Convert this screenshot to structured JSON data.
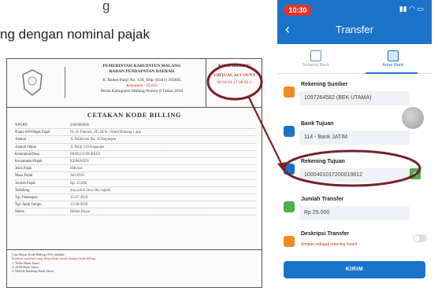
{
  "slide": {
    "top_fragment": "g",
    "heading": "ng dengan nominal pajak"
  },
  "document": {
    "agency_line1": "PEMERINTAH KABUPATEN MALANG",
    "agency_line2": "BADAN PENDAPATAN DAERAH",
    "agency_address": "Jl. Raden Panji No. 158, Telp. (0341) 392685",
    "agency_address2": "Kepanjen - 65163",
    "agency_address3": "Perda Kabupaten Malang Nomor 8 Tahun 2010",
    "kode_title": "KODE BILLING",
    "va_label": "VIRTUAL ACCOUNT",
    "va_number": "00 04 01 17 00 02 2",
    "title": "CETAKAN KODE BILLING",
    "rows": [
      {
        "k": "NPOPD",
        "v": "2000000000"
      },
      {
        "k": "Nama WP/Objek Pajak",
        "v": "Dr. H. Pamudi, SE, M.Si / Hotel Bintang 1 apa"
      },
      {
        "k": "Alamat",
        "v": "Jl. Pahlawan No. 10 Kepanjen"
      },
      {
        "k": "Alamat Objek",
        "v": "Jl. Panji 158 Kepanjen"
      },
      {
        "k": "Kelurahan/Desa",
        "v": "PANGGUNGREJO"
      },
      {
        "k": "Kecamatan/Objek",
        "v": "KEPANJEN"
      },
      {
        "k": "Jenis Pajak",
        "v": "Hiburan"
      },
      {
        "k": "Masa Pajak",
        "v": "Juli 2018"
      },
      {
        "k": "Jumlah Pajak",
        "v": "Rp. 25.000"
      },
      {
        "k": "Terbilang",
        "v": "dua puluh lima ribu rupiah"
      },
      {
        "k": "Tgl. Penetapan",
        "v": "15-07-2018"
      },
      {
        "k": "Tgl. Jatuh Tempo",
        "v": "15-08-2018"
      },
      {
        "k": "Status",
        "v": "Belum Bayar"
      }
    ],
    "notes_title": "Cara Bayar Kode Billing (VA) melalui:",
    "notes": [
      "1. Teller Bank Jatim",
      "2. ATM Bank Jatim",
      "3. Mobile Banking Bank Jatim"
    ],
    "notes_warning": "Pastikan nominal yang dibayarkan sesuai dengan kode billing"
  },
  "phone": {
    "time": "10:30",
    "status_icons": "all signal wifi battery",
    "title": "Transfer",
    "tabs": [
      {
        "label": "Sesama Bank"
      },
      {
        "label": "Antar Bank"
      }
    ],
    "fields": {
      "source_label": "Rekening Sumber",
      "source_value": "1097264582 (BEK UTAMA)",
      "bank_label": "Bank Tujuan",
      "bank_value": "114 - Bank JATIM",
      "dest_label": "Rekening Tujuan",
      "dest_value": "1000401017200019812",
      "amount_label": "Jumlah Transfer",
      "amount_value": "Rp 25.000",
      "desc_label": "Deskripsi Transfer",
      "desc_note": "Simpan sebagai rekening favorit"
    },
    "confirm_label": "KIRIM"
  },
  "colors": {
    "header_blue": "#1a73c9",
    "annotation_red": "#7a1f2b",
    "fav_green": "#4cae4c"
  }
}
